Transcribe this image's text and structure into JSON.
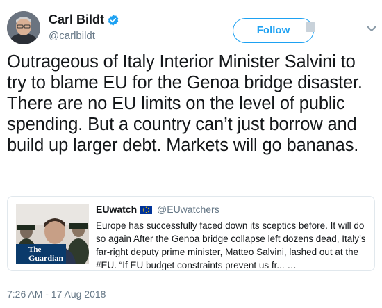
{
  "author": {
    "display_name": "Carl Bildt",
    "handle": "@carlbildt",
    "verified": true
  },
  "follow_label": "Follow",
  "tweet_text": "Outrageous of Italy Interior Minister Salvini to try to blame EU for the Genoa bridge disaster. There are no EU limits on the level of public spending. But a country can’t just borrow and build up larger debt. Markets will go bananas.",
  "quoted_tweet": {
    "display_name": "EUwatch",
    "handle": "@EUwatchers",
    "text": "Europe has successfully faced down its sceptics before. It will do so again After the Genoa bridge collapse left dozens dead, Italy’s far-right deputy prime minister, Matteo Salvini, lashed out at the #EU. “If EU budget constraints prevent us fr... …",
    "thumbnail_logo": {
      "line1": "The",
      "line2": "Guardian"
    }
  },
  "timestamp": "7:26 AM - 17 Aug 2018",
  "colors": {
    "accent": "#1da1f2",
    "text": "#14171a",
    "secondary_text": "#657786",
    "border": "#e1e8ed",
    "guardian_blue": "#0a3a6b"
  }
}
